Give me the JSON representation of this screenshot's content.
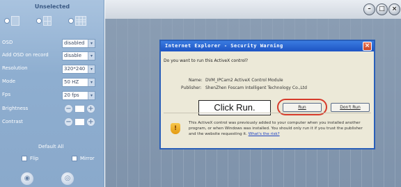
{
  "left_panel": {
    "header": "Unselected",
    "settings": [
      {
        "label": "OSD",
        "value": "disabled"
      },
      {
        "label": "Add OSD on record",
        "value": "disable"
      },
      {
        "label": "Resolution",
        "value": "320*240"
      },
      {
        "label": "Mode",
        "value": "50 HZ"
      },
      {
        "label": "Fps",
        "value": "20 fps"
      }
    ],
    "brightness_label": "Brightness",
    "contrast_label": "Contrast",
    "default_all": "Default All",
    "flip_label": "Flip",
    "mirror_label": "Mirror",
    "minus_symbol": "−",
    "plus_symbol": "+",
    "arrow_symbol": "▾"
  },
  "right_panel": {
    "window_controls": [
      "–",
      "□",
      "×"
    ]
  },
  "dialog": {
    "title": "Internet Explorer - Security Warning",
    "close_symbol": "×",
    "question": "Do you want to run this ActiveX control?",
    "name_label": "Name:",
    "name_value": "DVM_IPCam2 ActiveX Control Module",
    "publisher_label": "Publisher:",
    "publisher_value": "ShenZhen Foscam Intelligent Technology Co.,Ltd",
    "run_button": "Run",
    "dont_run_button": "Don't Run",
    "warning_icon": "!",
    "warning_text": "This ActiveX control was previously added to your computer when you installed another program, or when Windows was installed. You should only run it if you trust the publisher and the website requesting it.",
    "warning_link": "What's the risk?"
  },
  "callout": {
    "text": "Click Run."
  },
  "colors": {
    "panel_blue": "#8eaed0",
    "title_blue": "#1d54c4",
    "highlight_red": "#d63a2a"
  }
}
